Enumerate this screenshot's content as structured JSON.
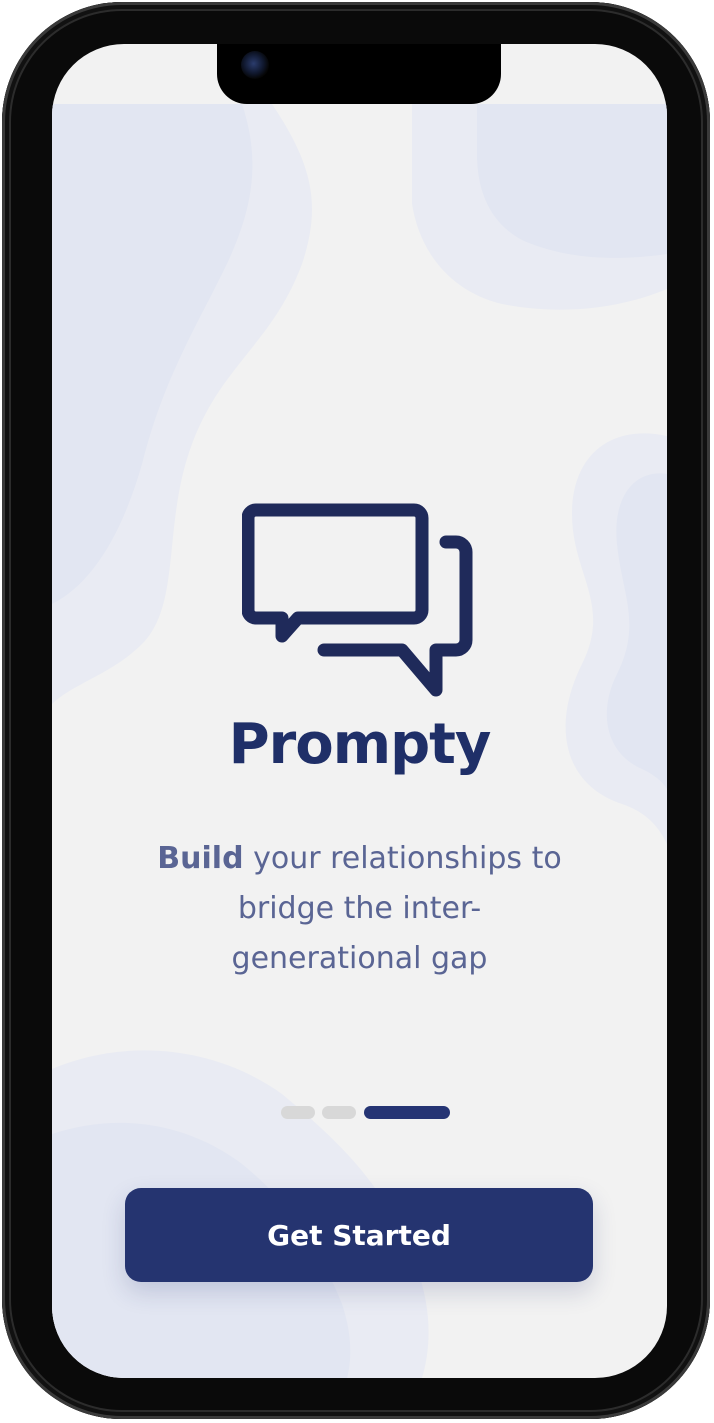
{
  "app": {
    "title": "Prompty",
    "icon": "chat-bubbles-icon",
    "brand_color": "#253470"
  },
  "tagline": {
    "bold": "Build",
    "rest_line1": " your relationships to",
    "line2": "bridge the inter-",
    "line3": "generational gap"
  },
  "pager": {
    "total": 3,
    "active_index": 2,
    "active_color": "#253474",
    "inactive_color": "#d8d8d8"
  },
  "cta": {
    "label": "Get Started"
  }
}
